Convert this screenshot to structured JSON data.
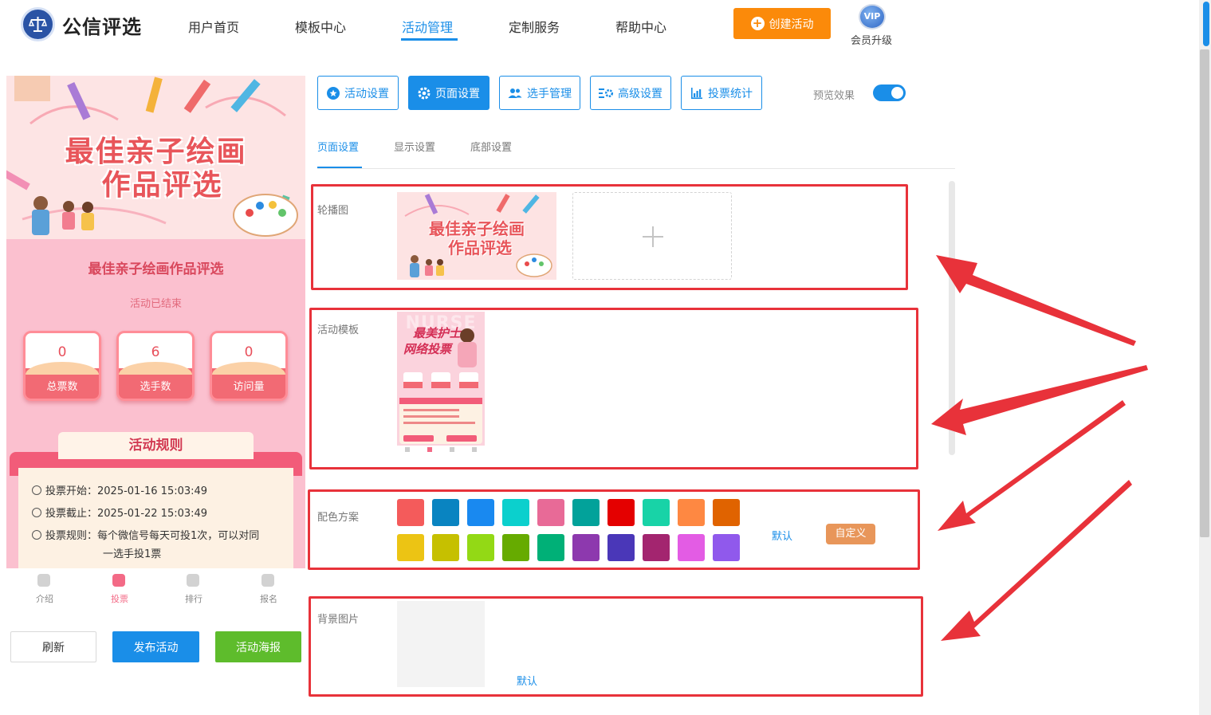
{
  "brand": {
    "name": "公信评选"
  },
  "nav": [
    {
      "label": "用户首页",
      "active": false
    },
    {
      "label": "模板中心",
      "active": false
    },
    {
      "label": "活动管理",
      "active": true
    },
    {
      "label": "定制服务",
      "active": false
    },
    {
      "label": "帮助中心",
      "active": false
    }
  ],
  "header": {
    "create_label": "创建活动",
    "vip_badge": "VIP",
    "vip_label": "会员升级"
  },
  "preview": {
    "banner_line1": "最佳亲子绘画",
    "banner_line2": "作品评选",
    "title": "最佳亲子绘画作品评选",
    "status": "活动已结束",
    "stats": [
      {
        "value": "0",
        "label": "总票数"
      },
      {
        "value": "6",
        "label": "选手数"
      },
      {
        "value": "0",
        "label": "访问量"
      }
    ],
    "rules_title": "活动规则",
    "rules": [
      "投票开始：2025-01-16 15:03:49",
      "投票截止：2025-01-22 15:03:49",
      "投票规则：每个微信号每天可投1次，可以对同",
      "一选手投1票"
    ],
    "tabbar": [
      {
        "label": "介绍",
        "active": false
      },
      {
        "label": "投票",
        "active": true
      },
      {
        "label": "排行",
        "active": false
      },
      {
        "label": "报名",
        "active": false
      }
    ],
    "buttons": {
      "refresh": "刷新",
      "publish": "发布活动",
      "poster": "活动海报"
    }
  },
  "settings": {
    "top_buttons": [
      {
        "label": "活动设置",
        "icon": "star-icon",
        "selected": false
      },
      {
        "label": "页面设置",
        "icon": "gear-icon",
        "selected": true
      },
      {
        "label": "选手管理",
        "icon": "users-icon",
        "selected": false
      },
      {
        "label": "高级设置",
        "icon": "advanced-settings-icon",
        "selected": false
      },
      {
        "label": "投票统计",
        "icon": "bar-chart-icon",
        "selected": false
      }
    ],
    "preview_toggle_label": "预览效果",
    "preview_toggle_on": true,
    "sub_tabs": [
      {
        "label": "页面设置",
        "active": true
      },
      {
        "label": "显示设置",
        "active": false
      },
      {
        "label": "底部设置",
        "active": false
      }
    ],
    "carousel_label": "轮播图",
    "carousel_thumb_line1": "最佳亲子绘画",
    "carousel_thumb_line2": "作品评选",
    "template_label": "活动模板",
    "template_thumb_heading": "NURSE",
    "template_thumb_line1": "最美护士",
    "template_thumb_line2": "网络投票",
    "color_label": "配色方案",
    "colors_row1": [
      "#f45b5b",
      "#0984c1",
      "#1989f0",
      "#0bd0cd",
      "#e86a97",
      "#02a29a",
      "#e40000",
      "#18d3a7",
      "#fe8842",
      "#e06300"
    ],
    "colors_row2": [
      "#ecc414",
      "#c6c000",
      "#93d915",
      "#66ab00",
      "#00b077",
      "#8d39ae",
      "#4a37b8",
      "#a3256f",
      "#e35ce4",
      "#9059ec"
    ],
    "color_default": "默认",
    "color_custom": "自定义",
    "bg_label": "背景图片",
    "bg_default": "默认"
  }
}
